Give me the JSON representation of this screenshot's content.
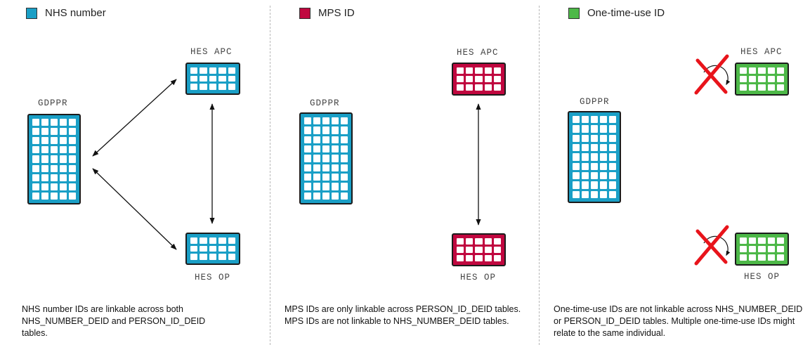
{
  "colors": {
    "nhs": "#1a9fc6",
    "mps": "#c0073f",
    "onetime": "#4db848",
    "cross": "#e8141b"
  },
  "panels": [
    {
      "legend": "NHS number",
      "labels": {
        "gdppr": "GDPPR",
        "apc": "HES APC",
        "op": "HES OP"
      },
      "description": "NHS number IDs are linkable across both NHS_NUMBER_DEID and PERSON_ID_DEID tables."
    },
    {
      "legend": "MPS ID",
      "labels": {
        "gdppr": "GDPPR",
        "apc": "HES APC",
        "op": "HES OP"
      },
      "description": "MPS IDs are only linkable across PERSON_ID_DEID tables. MPS IDs are not linkable to NHS_NUMBER_DEID tables."
    },
    {
      "legend": "One-time-use ID",
      "labels": {
        "gdppr": "GDPPR",
        "apc": "HES APC",
        "op": "HES OP"
      },
      "description": "One-time-use IDs are not linkable across NHS_NUMBER_DEID or PERSON_ID_DEID tables. Multiple one-time-use IDs might relate to the same individual."
    }
  ]
}
